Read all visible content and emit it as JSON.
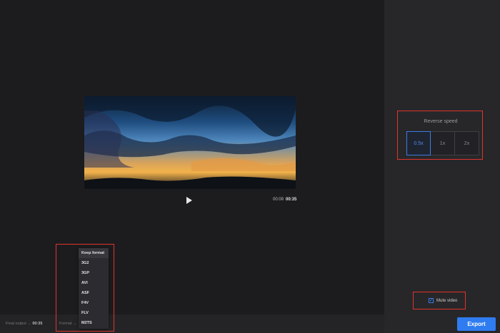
{
  "player": {
    "current_time": "00:00",
    "separator": "/",
    "duration": "00:35"
  },
  "speed": {
    "title": "Reverse speed",
    "options": [
      "0.5x",
      "1x",
      "2x"
    ],
    "selected": "0.5x"
  },
  "mute": {
    "label": "Mute video",
    "checked": true
  },
  "export": {
    "label": "Export"
  },
  "bottom": {
    "final_output_label": "Final output",
    "final_output_arrow": "→",
    "final_output_value": "00:35",
    "format_label": "Format →"
  },
  "format_dropdown": {
    "items": [
      "Keep format",
      "3G2",
      "3GP",
      "AVI",
      "ASF",
      "F4V",
      "FLV",
      "M2TS"
    ]
  },
  "colors": {
    "accent": "#2f7cf0",
    "highlight": "#e0332b"
  }
}
